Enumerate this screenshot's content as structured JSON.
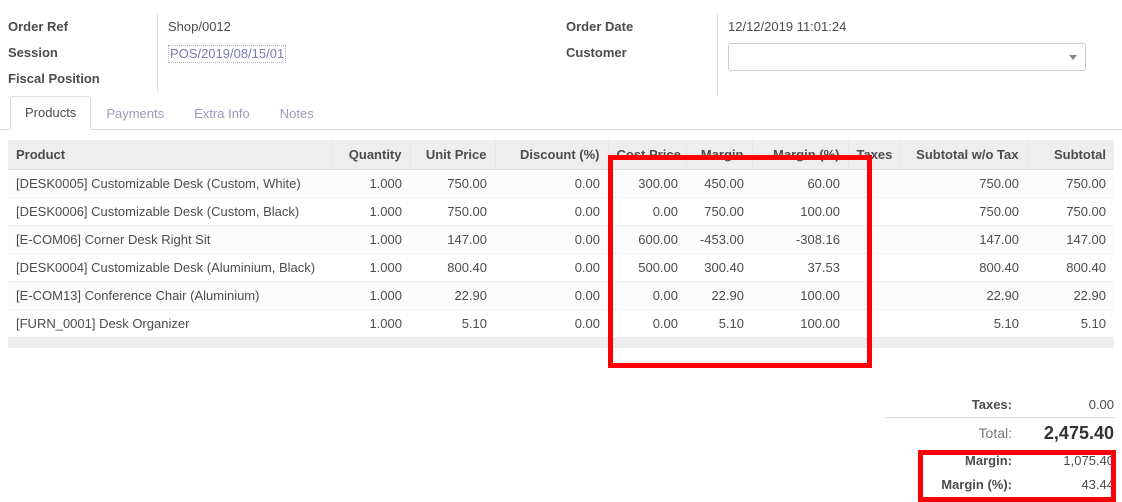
{
  "header": {
    "fields_left": [
      {
        "label": "Order Ref",
        "value": "Shop/0012",
        "type": "text"
      },
      {
        "label": "Session",
        "value": "POS/2019/08/15/01",
        "type": "link"
      },
      {
        "label": "Fiscal Position",
        "value": "",
        "type": "text"
      }
    ],
    "fields_right": [
      {
        "label": "Order Date",
        "value": "12/12/2019 11:01:24",
        "type": "text"
      },
      {
        "label": "Customer",
        "value": "",
        "type": "select"
      }
    ]
  },
  "tabs": [
    {
      "label": "Products",
      "active": true
    },
    {
      "label": "Payments",
      "active": false
    },
    {
      "label": "Extra Info",
      "active": false
    },
    {
      "label": "Notes",
      "active": false
    }
  ],
  "table": {
    "columns": [
      "Product",
      "Quantity",
      "Unit Price",
      "Discount (%)",
      "Cost Price",
      "Margin",
      "Margin (%)",
      "Taxes",
      "Subtotal w/o Tax",
      "Subtotal"
    ],
    "rows": [
      {
        "product": "[DESK0005] Customizable Desk (Custom, White)",
        "quantity": "1.000",
        "unit_price": "750.00",
        "discount": "0.00",
        "cost_price": "300.00",
        "margin": "450.00",
        "margin_pct": "60.00",
        "taxes": "",
        "subtotal_wo_tax": "750.00",
        "subtotal": "750.00"
      },
      {
        "product": "[DESK0006] Customizable Desk (Custom, Black)",
        "quantity": "1.000",
        "unit_price": "750.00",
        "discount": "0.00",
        "cost_price": "0.00",
        "margin": "750.00",
        "margin_pct": "100.00",
        "taxes": "",
        "subtotal_wo_tax": "750.00",
        "subtotal": "750.00"
      },
      {
        "product": "[E-COM06] Corner Desk Right Sit",
        "quantity": "1.000",
        "unit_price": "147.00",
        "discount": "0.00",
        "cost_price": "600.00",
        "margin": "-453.00",
        "margin_pct": "-308.16",
        "taxes": "",
        "subtotal_wo_tax": "147.00",
        "subtotal": "147.00"
      },
      {
        "product": "[DESK0004] Customizable Desk (Aluminium, Black)",
        "quantity": "1.000",
        "unit_price": "800.40",
        "discount": "0.00",
        "cost_price": "500.00",
        "margin": "300.40",
        "margin_pct": "37.53",
        "taxes": "",
        "subtotal_wo_tax": "800.40",
        "subtotal": "800.40"
      },
      {
        "product": "[E-COM13] Conference Chair (Aluminium)",
        "quantity": "1.000",
        "unit_price": "22.90",
        "discount": "0.00",
        "cost_price": "0.00",
        "margin": "22.90",
        "margin_pct": "100.00",
        "taxes": "",
        "subtotal_wo_tax": "22.90",
        "subtotal": "22.90"
      },
      {
        "product": "[FURN_0001] Desk Organizer",
        "quantity": "1.000",
        "unit_price": "5.10",
        "discount": "0.00",
        "cost_price": "0.00",
        "margin": "5.10",
        "margin_pct": "100.00",
        "taxes": "",
        "subtotal_wo_tax": "5.10",
        "subtotal": "5.10"
      }
    ]
  },
  "totals": {
    "taxes_label": "Taxes:",
    "taxes_value": "0.00",
    "total_label": "Total:",
    "total_value": "2,475.40",
    "margin_label": "Margin:",
    "margin_value": "1,075.40",
    "margin_pct_label": "Margin (%):",
    "margin_pct_value": "43.44"
  },
  "annotations": {
    "highlight_color": "#fb0007",
    "boxes": [
      {
        "name": "margin-columns-highlight"
      },
      {
        "name": "margin-totals-highlight"
      }
    ]
  }
}
